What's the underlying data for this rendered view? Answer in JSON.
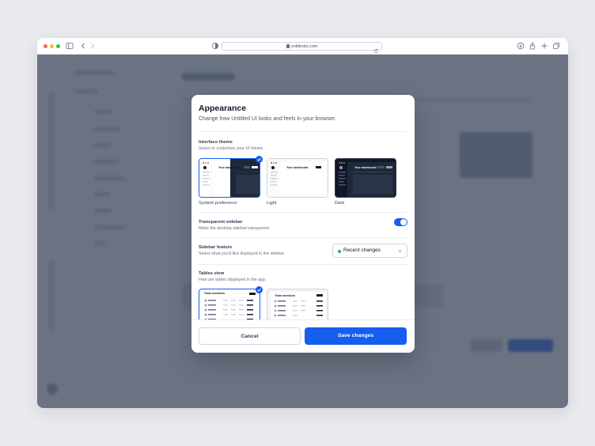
{
  "browser": {
    "url": "untitledui.com"
  },
  "modal": {
    "title": "Appearance",
    "subtitle": "Change how Untitled UI looks and feels in your browser.",
    "interface_theme": {
      "title": "Interface theme",
      "description": "Select or customize your UI theme.",
      "options": [
        {
          "label": "System preference",
          "selected": true
        },
        {
          "label": "Light",
          "selected": false
        },
        {
          "label": "Dark",
          "selected": false
        }
      ],
      "preview_heading": "Your dashboard"
    },
    "transparent_sidebar": {
      "title": "Transparent sidebar",
      "description": "Make the desktop sidebar transparent.",
      "enabled": true
    },
    "sidebar_feature": {
      "title": "Sidebar feature",
      "description": "Select what you'd like displayed in the sidebar.",
      "selected": "Recent changes"
    },
    "tables_view": {
      "title": "Tables view",
      "description": "How are tables displayed in the app.",
      "preview_heading": "Team members"
    },
    "cancel_label": "Cancel",
    "save_label": "Save changes"
  },
  "colors": {
    "accent": "#155eef",
    "status_dot": "#17b26a"
  }
}
